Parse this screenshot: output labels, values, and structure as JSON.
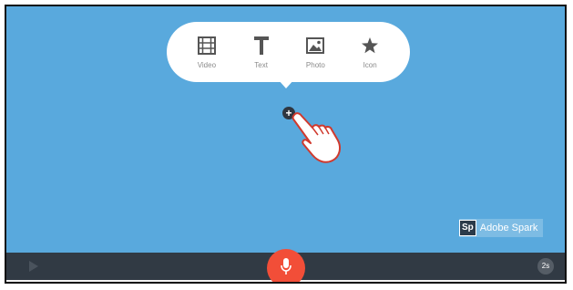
{
  "menu": {
    "items": [
      {
        "label": "Video",
        "icon": "film-icon"
      },
      {
        "label": "Text",
        "icon": "text-t-icon"
      },
      {
        "label": "Photo",
        "icon": "image-icon"
      },
      {
        "label": "Icon",
        "icon": "star-icon"
      }
    ]
  },
  "stage": {
    "add_button": "+",
    "watermark": {
      "logo": "Sp",
      "text": "Adobe Spark"
    }
  },
  "toolbar": {
    "duration": "2s"
  },
  "colors": {
    "stage_background": "#59a9dd",
    "toolbar_background": "#313a44",
    "mic_button": "#f24e38"
  }
}
